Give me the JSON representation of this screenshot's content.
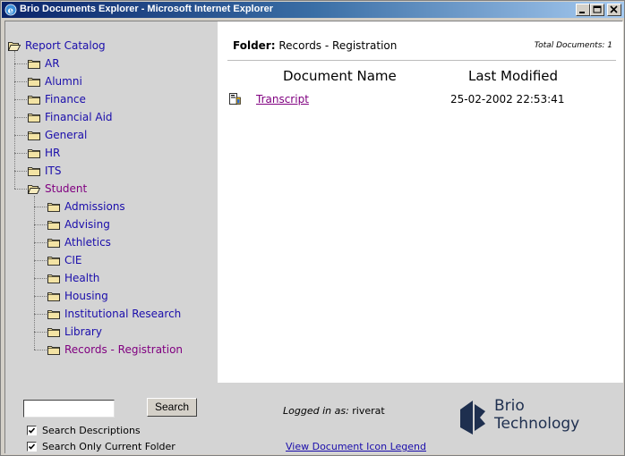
{
  "window": {
    "title": "Brio Documents Explorer - Microsoft Internet Explorer"
  },
  "tree": {
    "root": "Report Catalog",
    "items": [
      {
        "label": "AR"
      },
      {
        "label": "Alumni"
      },
      {
        "label": "Finance"
      },
      {
        "label": "Financial Aid"
      },
      {
        "label": "General"
      },
      {
        "label": "HR"
      },
      {
        "label": "ITS"
      },
      {
        "label": "Student"
      }
    ],
    "student_children": [
      {
        "label": "Admissions"
      },
      {
        "label": "Advising"
      },
      {
        "label": "Athletics"
      },
      {
        "label": "CIE"
      },
      {
        "label": "Health"
      },
      {
        "label": "Housing"
      },
      {
        "label": "Institutional Research"
      },
      {
        "label": "Library"
      },
      {
        "label": "Records - Registration"
      }
    ]
  },
  "folder": {
    "prefix": "Folder:",
    "name": "Records - Registration",
    "total_label": "Total Documents: 1"
  },
  "table": {
    "columns": [
      "Document Name",
      "Last Modified"
    ],
    "rows": [
      {
        "name": "Transcript",
        "modified": "25-02-2002 22:53:41",
        "icon": "report-document-icon"
      }
    ]
  },
  "bottom": {
    "search_value": "",
    "search_button": "Search",
    "check_descriptions": "Search Descriptions",
    "check_descriptions_checked": true,
    "check_current_folder": "Search Only Current Folder",
    "check_current_folder_checked": true,
    "logged_in_prefix": "Logged in as:",
    "logged_in_user": "riverat",
    "legend_link": "View Document Icon Legend"
  },
  "logo": {
    "line1": "Brio",
    "line2": "Technology"
  },
  "colors": {
    "link": "#1a0dab",
    "visited": "#800080",
    "pane_gray": "#d4d4d4",
    "titlebar": "#0a246a"
  }
}
